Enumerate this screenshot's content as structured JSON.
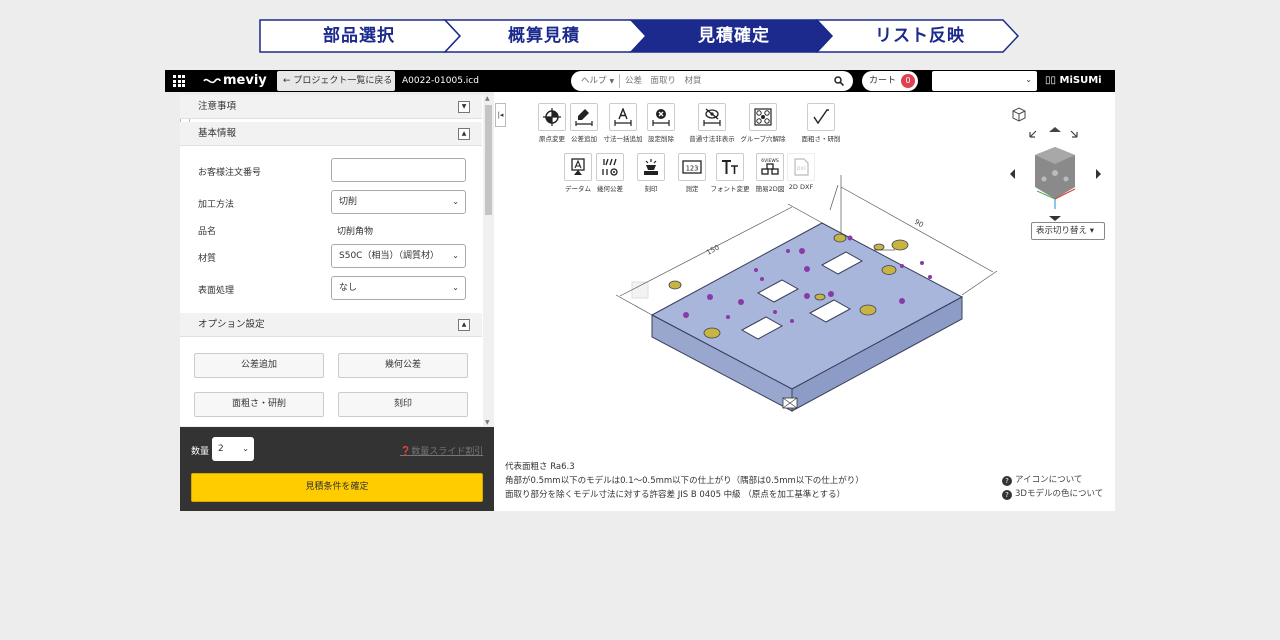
{
  "steps": [
    {
      "label": "部品選択",
      "active": false
    },
    {
      "label": "概算見積",
      "active": false
    },
    {
      "label": "見積確定",
      "active": true
    },
    {
      "label": "リスト反映",
      "active": false
    }
  ],
  "topbar": {
    "logo": "meviy",
    "back_label": "プロジェクト一覧に戻る",
    "filename": "A0022-01005.icd",
    "help_label": "ヘルプ",
    "search_placeholder": "公差　面取り　材質",
    "cart_label": "カート",
    "cart_count": "0",
    "brand": "MiSUMi"
  },
  "left": {
    "notice_header": "注意事項",
    "basic_header": "基本情報",
    "rows": [
      {
        "label": "お客様注文番号",
        "value": ""
      },
      {
        "label": "加工方法",
        "value": "切削"
      },
      {
        "label": "品名",
        "value": "切削角物"
      },
      {
        "label": "材質",
        "value": "S50C（相当）（調質材）"
      },
      {
        "label": "表面処理",
        "value": "なし"
      }
    ],
    "option_header": "オプション設定",
    "options": [
      "公差追加",
      "幾何公差",
      "面粗さ・研削",
      "刻印"
    ],
    "qty_label": "数量",
    "qty_value": "2",
    "volume_discount": "数量スライド割引",
    "confirm_button": "見積条件を確定"
  },
  "toolbar_row1": [
    "原点変更",
    "公差追加",
    "寸法一括追加",
    "設定削除",
    "普通寸法非表示",
    "グループ穴解除",
    "面粗さ・研削"
  ],
  "toolbar_row2": [
    "データム",
    "幾何公差",
    "刻印",
    "測定",
    "フォント変更",
    "簡易2D図",
    "2D DXF"
  ],
  "view_switch": "表示切り替え",
  "dims": {
    "long": "150",
    "short": "90"
  },
  "notes": [
    "代表面粗さ Ra6.3",
    "角部が0.5mm以下のモデルは0.1～0.5mm以下の仕上がり（隅部は0.5mm以下の仕上がり）",
    "面取り部分を除くモデル寸法に対する許容差 JIS B 0405 中級 （原点を加工基準とする）"
  ],
  "help_links": [
    "アイコンについて",
    "3Dモデルの色について"
  ],
  "colors": {
    "accent": "#1b2a8c",
    "yellow": "#ffcc00",
    "part": "#a8b6dc"
  }
}
